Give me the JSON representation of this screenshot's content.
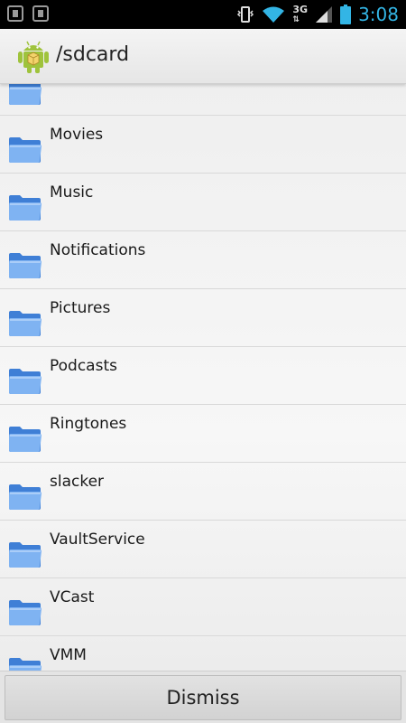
{
  "status_bar": {
    "time": "3:08",
    "network": "3G",
    "icons": [
      "usb-debug-icon",
      "download-icon",
      "vibrate-icon",
      "wifi-icon",
      "3g-icon",
      "signal-icon",
      "battery-icon"
    ]
  },
  "action_bar": {
    "title": "/sdcard",
    "icon": "android-app-icon"
  },
  "list": {
    "items": [
      {
        "label": ""
      },
      {
        "label": "Movies"
      },
      {
        "label": "Music"
      },
      {
        "label": "Notifications"
      },
      {
        "label": "Pictures"
      },
      {
        "label": "Podcasts"
      },
      {
        "label": "Ringtones"
      },
      {
        "label": "slacker"
      },
      {
        "label": "VaultService"
      },
      {
        "label": "VCast"
      },
      {
        "label": "VMM"
      }
    ]
  },
  "footer": {
    "dismiss_label": "Dismiss"
  },
  "colors": {
    "accent": "#33b5e5",
    "folder": "#5b9be8"
  }
}
